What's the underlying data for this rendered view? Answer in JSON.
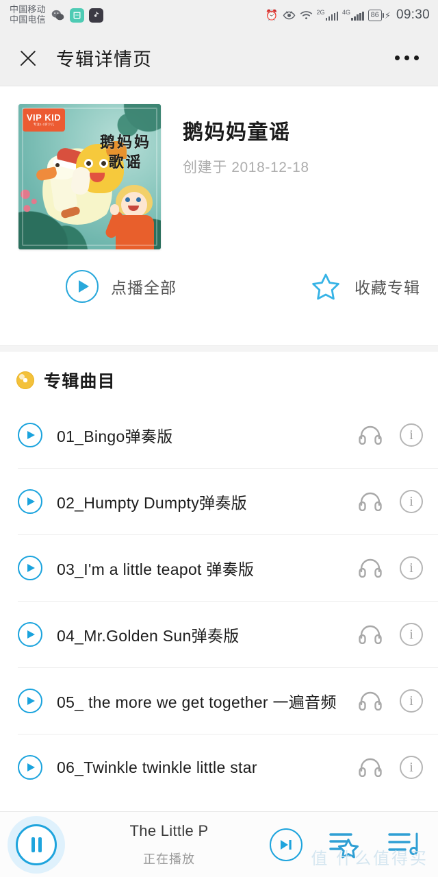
{
  "status_bar": {
    "carrier_primary": "中国移动",
    "carrier_secondary": "中国电信",
    "app_icons": [
      "wechat-icon",
      "mi-icon",
      "tiktok-icon"
    ],
    "alarm_icon": "alarm-icon",
    "eye_icon": "eye-care-icon",
    "wifi_icon": "wifi-icon",
    "signal_1_label": "2G",
    "signal_2_label": "4G",
    "battery_level": "86",
    "charging": true,
    "time": "09:30"
  },
  "nav": {
    "close_label": "close-icon",
    "title": "专辑详情页",
    "more_label": "more-icon"
  },
  "album": {
    "cover_badge_main": "VIP KID",
    "cover_badge_sub": "专注1-2岁少儿",
    "cover_title_line1": "鹅妈妈",
    "cover_title_line2": "歌谣",
    "title": "鹅妈妈童谣",
    "created_label": "创建于 2018-12-18"
  },
  "actions": {
    "play_all": "点播全部",
    "favorite_album": "收藏专辑"
  },
  "tracks_section": {
    "title": "专辑曲目",
    "icon": "disc-icon",
    "items": [
      {
        "name": "01_Bingo弹奏版"
      },
      {
        "name": "02_Humpty Dumpty弹奏版"
      },
      {
        "name": "03_I'm a little teapot 弹奏版"
      },
      {
        "name": "04_Mr.Golden Sun弹奏版"
      },
      {
        "name": "05_ the more we get together 一遍音频"
      },
      {
        "name": "06_Twinkle twinkle little star"
      }
    ],
    "row_icons": {
      "headphone": "headphone-icon",
      "info": "info-icon"
    }
  },
  "player": {
    "pause_label": "pause-icon",
    "now_playing_title": "The Little P",
    "now_playing_state": "正在播放",
    "next_label": "next-track-icon",
    "favorites_list_label": "favorites-list-icon",
    "playlist_label": "playlist-icon"
  },
  "watermark": {
    "text": "值 什么值得买"
  },
  "colors": {
    "accent_blue": "#1ea4dd",
    "accent_blue_light": "#29a8db",
    "disc_yellow": "#f3c13a",
    "header_bg": "#f0f0f0",
    "badge_orange": "#ec5b32"
  }
}
